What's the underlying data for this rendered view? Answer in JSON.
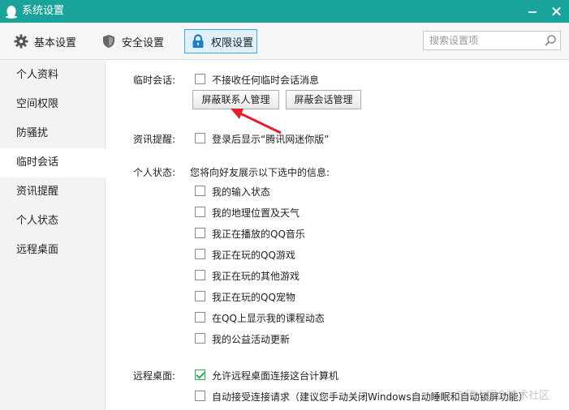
{
  "window": {
    "title": "系统设置",
    "accent_color": "#1aa39a",
    "icon": "penguin-icon"
  },
  "toolbar": {
    "tabs": [
      {
        "label": "基本设置",
        "icon": "gear-icon",
        "selected": false
      },
      {
        "label": "安全设置",
        "icon": "shield-icon",
        "selected": false
      },
      {
        "label": "权限设置",
        "icon": "lock-icon",
        "selected": true
      }
    ],
    "search": {
      "placeholder": "搜索设置项",
      "value": ""
    }
  },
  "sidebar": {
    "items": [
      {
        "label": "个人资料",
        "active": false
      },
      {
        "label": "空间权限",
        "active": false
      },
      {
        "label": "防骚扰",
        "active": false
      },
      {
        "label": "临时会话",
        "active": true
      },
      {
        "label": "资讯提醒",
        "active": false
      },
      {
        "label": "个人状态",
        "active": false
      },
      {
        "label": "远程桌面",
        "active": false
      }
    ]
  },
  "main": {
    "temp_session": {
      "label": "临时会话:",
      "option": {
        "label": "不接收任何临时会话消息",
        "checked": false
      },
      "buttons": [
        "屏蔽联系人管理",
        "屏蔽会话管理"
      ]
    },
    "news": {
      "label": "资讯提醒:",
      "option": {
        "label": "登录后显示“腾讯网迷你版”",
        "checked": false
      }
    },
    "status": {
      "label": "个人状态:",
      "description": "您将向好友展示以下选中的信息:",
      "options": [
        {
          "label": "我的输入状态",
          "checked": false
        },
        {
          "label": "我的地理位置及天气",
          "checked": false
        },
        {
          "label": "我正在播放的QQ音乐",
          "checked": false
        },
        {
          "label": "我正在玩的QQ游戏",
          "checked": false
        },
        {
          "label": "我正在玩的其他游戏",
          "checked": false
        },
        {
          "label": "我正在玩的QQ宠物",
          "checked": false
        },
        {
          "label": "在QQ上显示我的课程动态",
          "checked": false
        },
        {
          "label": "我的公益活动更新",
          "checked": false
        }
      ]
    },
    "remote": {
      "label": "远程桌面:",
      "options": [
        {
          "label": "允许远程桌面连接这台计算机",
          "checked": true
        },
        {
          "label": "自动接受连接请求（建议您手动关闭Windows自动睡眠和自动锁屏功能）",
          "checked": false
        }
      ]
    }
  },
  "watermark": "@稀土掘金技术社区",
  "annotation_arrow_color": "#e0202a"
}
